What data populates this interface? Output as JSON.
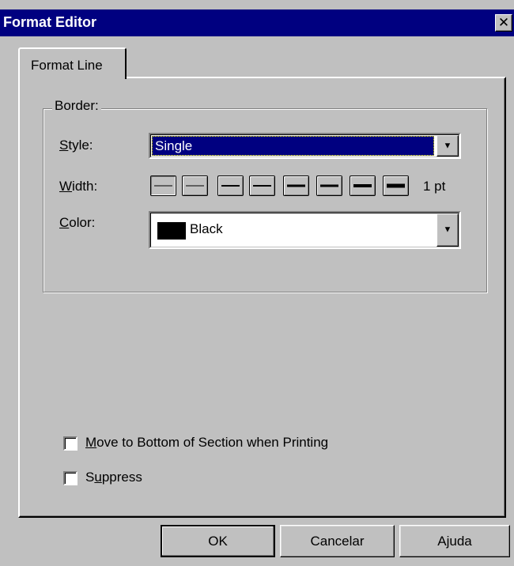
{
  "window": {
    "title": "Format Editor",
    "close_glyph": "✕"
  },
  "tabs": [
    {
      "label": "Format Line",
      "active": true
    }
  ],
  "border_group": {
    "label": "Border:",
    "style": {
      "label_ul": "S",
      "label_rest": "tyle:",
      "value": "Single"
    },
    "width": {
      "label_ul": "W",
      "label_rest": "idth:",
      "value": "1 pt",
      "option_count": 8,
      "selected_index": 0
    },
    "color": {
      "label_ul": "C",
      "label_rest": "olor:",
      "value": "Black",
      "swatch": "#000000"
    }
  },
  "checkboxes": {
    "move_bottom": {
      "ul": "M",
      "rest": "ove to Bottom of Section when Printing",
      "checked": false
    },
    "suppress": {
      "pre": "S",
      "ul": "u",
      "rest": "ppress",
      "checked": false
    }
  },
  "buttons": {
    "ok": "OK",
    "cancel": "Cancelar",
    "help": "Ajuda"
  },
  "icons": {
    "dropdown": "triangle-down-icon",
    "close": "close-icon"
  },
  "colors": {
    "titlebar": "#000080",
    "face": "#c0c0c0",
    "selection": "#000080"
  }
}
